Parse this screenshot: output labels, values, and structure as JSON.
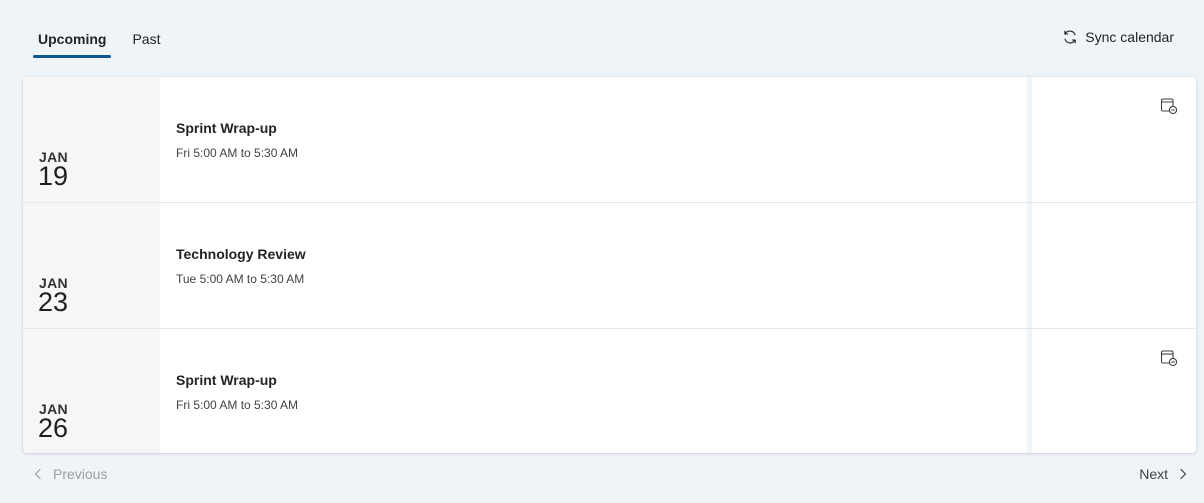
{
  "tabs": [
    {
      "label": "Upcoming",
      "active": true
    },
    {
      "label": "Past",
      "active": false
    }
  ],
  "sync": {
    "label": "Sync calendar",
    "icon": "sync-icon"
  },
  "events": [
    {
      "month": "JAN",
      "day": "19",
      "title": "Sprint Wrap-up",
      "time": "Fri 5:00 AM to 5:30 AM",
      "action_icon": "calendar-remove-icon"
    },
    {
      "month": "JAN",
      "day": "23",
      "title": "Technology Review",
      "time": "Tue 5:00 AM to 5:30 AM",
      "action_icon": null
    },
    {
      "month": "JAN",
      "day": "26",
      "title": "Sprint Wrap-up",
      "time": "Fri 5:00 AM to 5:30 AM",
      "action_icon": "calendar-remove-icon"
    }
  ],
  "pagination": {
    "previous_label": "Previous",
    "next_label": "Next",
    "previous_disabled": true
  },
  "colors": {
    "accent": "#0f548c",
    "background": "#eff4f8",
    "date_column": "#f6f6f6"
  }
}
